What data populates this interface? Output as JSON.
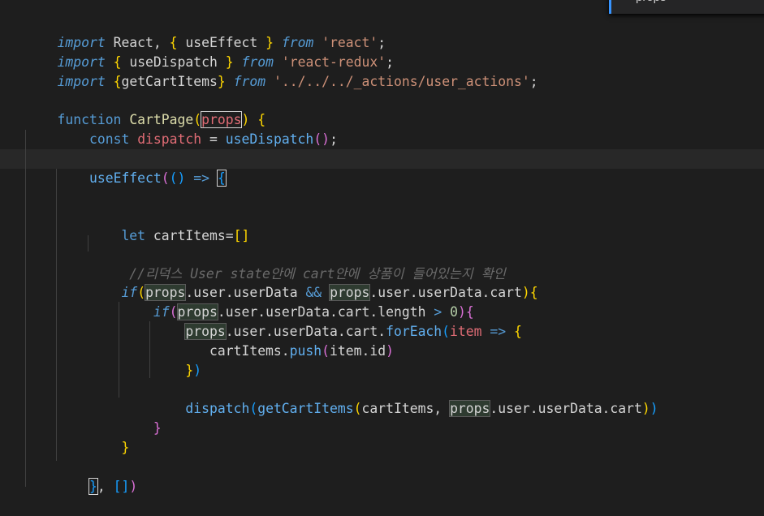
{
  "find_widget": {
    "search_term": "props"
  },
  "code": {
    "l1": {
      "a": "import",
      "b": " React, ",
      "c": "{",
      "d": " useEffect ",
      "e": "}",
      "f": " from",
      "g": " ",
      "h": "'react'",
      "i": ";"
    },
    "l2": {
      "a": "import",
      "b": " ",
      "c": "{",
      "d": " useDispatch ",
      "e": "}",
      "f": " from",
      "g": " ",
      "h": "'react-redux'",
      "i": ";"
    },
    "l3": {
      "a": "import",
      "b": " ",
      "c": "{",
      "d": "getCartItems",
      "e": "}",
      "f": " from",
      "g": " ",
      "h": "'../../../_actions/user_actions'",
      "i": ";"
    },
    "l5": {
      "a": "function",
      "b": " ",
      "c": "CartPage",
      "d": "(",
      "e": "props",
      "f": ")",
      "g": " ",
      "h": "{"
    },
    "l6": {
      "a": "    ",
      "b": "const",
      "c": " ",
      "d": "dispatch",
      "e": " = ",
      "f": "useDispatch",
      "g": "()",
      "h": ";"
    },
    "l8": {
      "a": "    ",
      "b": "useEffect",
      "c": "(",
      "d": "()",
      "e": " => ",
      "f": "{"
    },
    "l11": {
      "a": "        ",
      "b": "let",
      "c": " cartItems",
      "d": "=",
      "e": "[]"
    },
    "l13": {
      "a": "         ",
      "b": "//리덕스 User state안에 cart안에 상품이 들어있는지 확인"
    },
    "l14": {
      "a": "        ",
      "b": "if",
      "c": "(",
      "d": "props",
      "e": ".user.userData ",
      "f": "&&",
      "g": " ",
      "h": "props",
      "i": ".user.userData.cart",
      "j": ")",
      "k": "{"
    },
    "l15": {
      "a": "            ",
      "b": "if",
      "c": "(",
      "d": "props",
      "e": ".user.userData.cart.length ",
      "f": ">",
      "g": " ",
      "h": "0",
      "i": ")",
      "j": "{"
    },
    "l16": {
      "a": "                ",
      "b": "props",
      "c": ".user.userData.cart.",
      "d": "forEach",
      "e": "(",
      "f": "item",
      "g": " => ",
      "h": "{"
    },
    "l17": {
      "a": "                   ",
      "b": "cartItems.",
      "c": "push",
      "d": "(",
      "e": "item.id",
      "f": ")"
    },
    "l18": {
      "a": "                ",
      "b": "}",
      "c": ")"
    },
    "l20": {
      "a": "                ",
      "b": "dispatch",
      "c": "(",
      "d": "getCartItems",
      "e": "(",
      "f": "cartItems, ",
      "g": "props",
      "h": ".user.userData.cart",
      "i": ")",
      "j": ")"
    },
    "l21": {
      "a": "            ",
      "b": "}"
    },
    "l22": {
      "a": "        ",
      "b": "}"
    },
    "l24": {
      "a": "    ",
      "b": "}",
      "c": ", ",
      "d": "[]",
      "e": ")"
    }
  },
  "colors": {
    "background": "#1e1e1e",
    "keyword": "#569cd6",
    "string": "#ce9178",
    "function": "#dcdcaa",
    "variable": "#9cdcfe",
    "bracket_gold": "#ffd700",
    "bracket_purple": "#da70d6",
    "bracket_blue": "#179fff",
    "comment": "#6a6a6a",
    "parameter": "#e06c75"
  }
}
